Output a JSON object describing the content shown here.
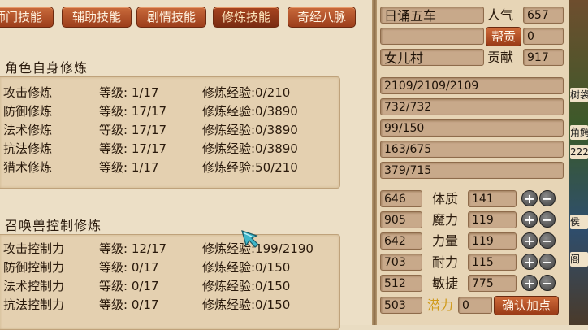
{
  "tabs": [
    {
      "label": "师门技能",
      "active": false
    },
    {
      "label": "辅助技能",
      "active": false
    },
    {
      "label": "剧情技能",
      "active": false
    },
    {
      "label": "修炼技能",
      "active": true
    },
    {
      "label": "奇经八脉",
      "active": false
    }
  ],
  "self_cultivation": {
    "title": "角色自身修炼",
    "rows": [
      {
        "name": "攻击修炼",
        "level": "等级:  1/17",
        "exp": "修炼经验:0/210"
      },
      {
        "name": "防御修炼",
        "level": "等级: 17/17",
        "exp": "修炼经验:0/3890"
      },
      {
        "name": "法术修炼",
        "level": "等级: 17/17",
        "exp": "修炼经验:0/3890"
      },
      {
        "name": "抗法修炼",
        "level": "等级: 17/17",
        "exp": "修炼经验:0/3890"
      },
      {
        "name": "猎术修炼",
        "level": "等级:  1/17",
        "exp": "修炼经验:50/210"
      }
    ]
  },
  "pet_cultivation": {
    "title": "召唤兽控制修炼",
    "rows": [
      {
        "name": "攻击控制力",
        "level": "等级: 12/17",
        "exp": "修炼经验:199/2190"
      },
      {
        "name": "防御控制力",
        "level": "等级:  0/17",
        "exp": "修炼经验:0/150"
      },
      {
        "name": "法术控制力",
        "level": "等级:  0/17",
        "exp": "修炼经验:0/150"
      },
      {
        "name": "抗法控制力",
        "level": "等级:  0/17",
        "exp": "修炼经验:0/150"
      }
    ]
  },
  "info": {
    "title_value": "日诵五车",
    "popularity_label": "人气",
    "popularity_value": "657",
    "gang_button": "帮贡",
    "gang_value": "0",
    "gang_name": "",
    "sect_value": "女儿村",
    "contribution_label": "贡献",
    "contribution_value": "917"
  },
  "stat_bars": [
    "2109/2109/2109",
    "732/732",
    "99/150",
    "163/675",
    "379/715"
  ],
  "attributes": [
    {
      "left": "646",
      "label": "体质",
      "value": "141"
    },
    {
      "left": "905",
      "label": "魔力",
      "value": "119"
    },
    {
      "left": "642",
      "label": "力量",
      "value": "119"
    },
    {
      "left": "703",
      "label": "耐力",
      "value": "115"
    },
    {
      "left": "512",
      "label": "敏捷",
      "value": "775"
    }
  ],
  "potential": {
    "left": "503",
    "label": "潜力",
    "value": "0"
  },
  "confirm_button": "确认加点",
  "plus_symbol": "+",
  "minus_symbol": "−",
  "strip_texts": [
    "树袋",
    "角鳄",
    "222",
    "侯",
    "阁"
  ],
  "colors": {
    "accent_red": "#b04a22",
    "potential_label": "#d09a1a"
  }
}
